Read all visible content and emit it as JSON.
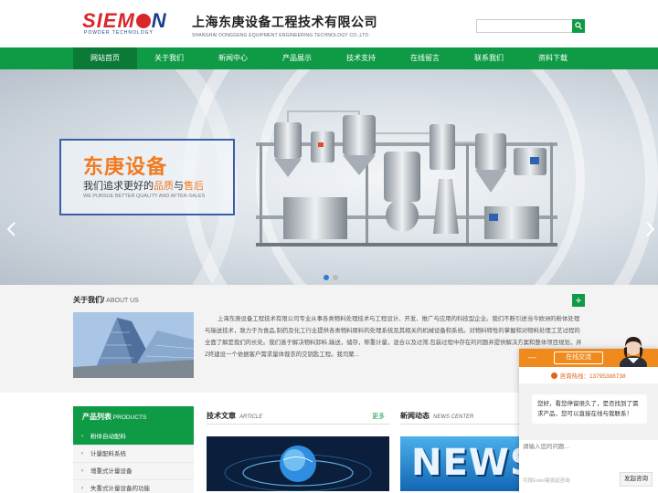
{
  "header": {
    "logo_word_a": "SIEM",
    "logo_word_b": "N",
    "logo_sub": "POWDER TECHNOLOGY",
    "company_cn": "上海东庚设备工程技术有限公司",
    "company_en": "SHANGHAI DONGGENG EQUIPMENT ENGINEERING TECHNOLOGY CO.,LTD.",
    "search_placeholder": "",
    "search_icon": "search-icon"
  },
  "nav": {
    "items": [
      "网站首页",
      "关于我们",
      "新闻中心",
      "产品展示",
      "技术支持",
      "在线留言",
      "联系我们",
      "资料下载"
    ],
    "active_index": 0
  },
  "banner": {
    "title": "东庚设备",
    "slogan_prefix": "我们追求更好的",
    "slogan_a": "品质",
    "slogan_and": "与",
    "slogan_b": "售后",
    "slogan_en": "WE PURSUE BETTER QUALITY AND AFTER-SALES",
    "slide_count": 2,
    "active_slide": 0
  },
  "about": {
    "title": "关于我们/",
    "title_en": " ABOUT US",
    "more_symbol": "+",
    "text": "上海东庚设备工程技术有限公司专业从事各类物料处理技术与工程设计、开发、推广与应用的科技型企业。我们不断引进当今欧洲的粉体处理与输送技术，致力于为食品,制药及化工行业提供各类物料原料的处理系统及其相关的机械设备和系统。对物料特性的掌握和对物料处理工艺过程的全面了解是我们的长处。我们善于解决物料卸料,输送，储存，称重计量，混合以及过筛,包装过程中存在的问题并提供解决方案和整体项目规划，并Z终建设一个依据客户需求量体裁衣的交钥匙工程。我司聚..."
  },
  "products": {
    "title": "产品列表",
    "title_en": " PRODUCTS",
    "items": [
      "粉体自动配料",
      "计量配料系统",
      "增重式计量设备",
      "失重式计量设备的功能"
    ],
    "active_index": 0
  },
  "articles": {
    "title": "技术文章",
    "title_en": "ARTICLE",
    "more": "更多"
  },
  "news": {
    "title": "新闻动态",
    "title_en": "NEWS CENTER",
    "image_word": "NEWS"
  },
  "chat": {
    "minimize": "—",
    "tab": "在线交流",
    "hotline": "咨询热线：13795388738",
    "message": "您好，看您停留很久了，是否找到了需求产品，您可以直接在线与我联系！",
    "input_placeholder": "请输入您的问题...",
    "hint": "可按Enter键发起咨询",
    "send": "发起咨询"
  },
  "colors": {
    "brand_green": "#0f9a46",
    "accent_orange": "#f07a1e",
    "logo_blue": "#1a3f8f",
    "logo_red": "#d8262b"
  }
}
